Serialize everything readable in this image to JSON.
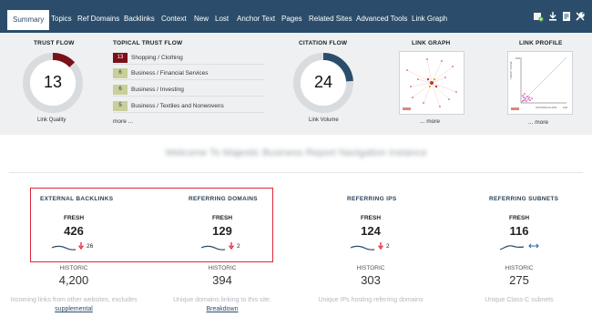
{
  "nav": {
    "tabs": [
      {
        "label": "Summary",
        "active": true
      },
      {
        "label": "Topics"
      },
      {
        "label": "Ref Domains"
      },
      {
        "label": "Backlinks"
      },
      {
        "label": "Context"
      },
      {
        "label": "New"
      },
      {
        "label": "Lost"
      },
      {
        "label": "Anchor Text"
      },
      {
        "label": "Pages"
      },
      {
        "label": "Related Sites"
      },
      {
        "label": "Advanced Tools"
      },
      {
        "label": "Link Graph"
      }
    ],
    "icons": [
      "bookmark-icon",
      "download-icon",
      "report-icon",
      "tools-icon"
    ],
    "bg_color": "#2b4d6b"
  },
  "summary": {
    "trust_flow": {
      "title": "TRUST FLOW",
      "value": "13",
      "caption": "Link Quality",
      "fill": 0.13,
      "color": "#7a1018"
    },
    "topical": {
      "title": "TOPICAL TRUST FLOW",
      "rows": [
        {
          "score": "13",
          "label": "Shopping / Clothing",
          "color": "#7a1018",
          "text_color": "#ffffff"
        },
        {
          "score": "6",
          "label": "Business / Financial Services",
          "color": "#c9cf9a",
          "text_color": "#333333"
        },
        {
          "score": "6",
          "label": "Business / Investing",
          "color": "#c9cf9a",
          "text_color": "#333333"
        },
        {
          "score": "5",
          "label": "Business / Textiles and Nonwovens",
          "color": "#c9cf9a",
          "text_color": "#333333"
        }
      ],
      "more": "more ..."
    },
    "citation_flow": {
      "title": "CITATION FLOW",
      "value": "24",
      "caption": "Link Volume",
      "fill": 0.24,
      "color": "#2b4d6b"
    },
    "link_graph": {
      "title": "LINK GRAPH",
      "more": "... more"
    },
    "link_profile": {
      "title": "LINK PROFILE",
      "more": "... more",
      "x_axis": "CITATION FLOW",
      "y_axis": "TRUST FLOW",
      "x_max": "100",
      "y_max": "100"
    }
  },
  "heading_blurred": "Welcome To Majestic Business Report Navigation Instance",
  "metrics": [
    {
      "title": "EXTERNAL BACKLINKS",
      "fresh_label": "FRESH",
      "fresh_value": "426",
      "delta": "26",
      "delta_dir": "down",
      "historic_label": "HISTORIC",
      "historic_value": "4,200",
      "desc": "Incoming links from other websites, excludes ",
      "desc_link": "supplemental"
    },
    {
      "title": "REFERRING DOMAINS",
      "fresh_label": "FRESH",
      "fresh_value": "129",
      "delta": "2",
      "delta_dir": "down",
      "historic_label": "HISTORIC",
      "historic_value": "394",
      "desc": "Unique domains linking to this site.",
      "desc_link": "Breakdown"
    },
    {
      "title": "REFERRING IPS",
      "fresh_label": "FRESH",
      "fresh_value": "124",
      "delta": "2",
      "delta_dir": "down",
      "historic_label": "HISTORIC",
      "historic_value": "303",
      "desc": "Unique IPs hosting referring domains",
      "desc_link": ""
    },
    {
      "title": "REFERRING SUBNETS",
      "fresh_label": "FRESH",
      "fresh_value": "116",
      "delta": "",
      "delta_dir": "flat",
      "historic_label": "HISTORIC",
      "historic_value": "275",
      "desc": "Unique Class-C subnets",
      "desc_link": ""
    }
  ],
  "colors": {
    "down": "#e0253a",
    "flat": "#2b6da8",
    "highlight": "#e0253a"
  }
}
